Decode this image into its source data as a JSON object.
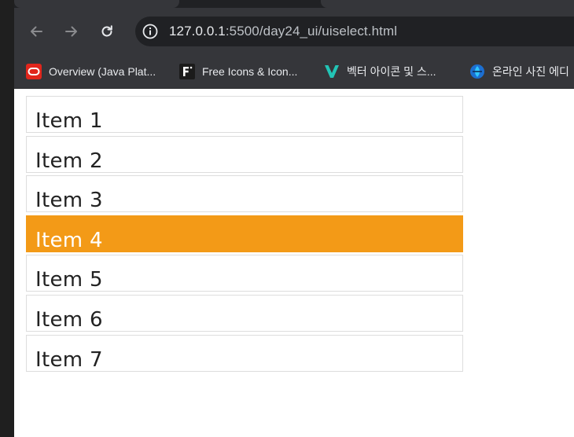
{
  "browser": {
    "url_host": "127.0.0.1",
    "url_path": ":5500/day24_ui/uiselect.html"
  },
  "bookmarks": [
    {
      "label": "Overview (Java Plat...",
      "icon": "oracle-icon"
    },
    {
      "label": "Free Icons & Icon...",
      "icon": "flaticon-icon"
    },
    {
      "label": "벡터 아이콘 및 스...",
      "icon": "vector-icon"
    },
    {
      "label": "온라인 사진 에디",
      "icon": "photo-editor-icon"
    }
  ],
  "list": {
    "items": [
      {
        "label": "Item 1",
        "selected": false
      },
      {
        "label": "Item 2",
        "selected": false
      },
      {
        "label": "Item 3",
        "selected": false
      },
      {
        "label": "Item 4",
        "selected": true
      },
      {
        "label": "Item 5",
        "selected": false
      },
      {
        "label": "Item 6",
        "selected": false
      },
      {
        "label": "Item 7",
        "selected": false
      }
    ]
  },
  "colors": {
    "selected": "#f39a17",
    "border": "#dddddd",
    "text": "#222222"
  }
}
